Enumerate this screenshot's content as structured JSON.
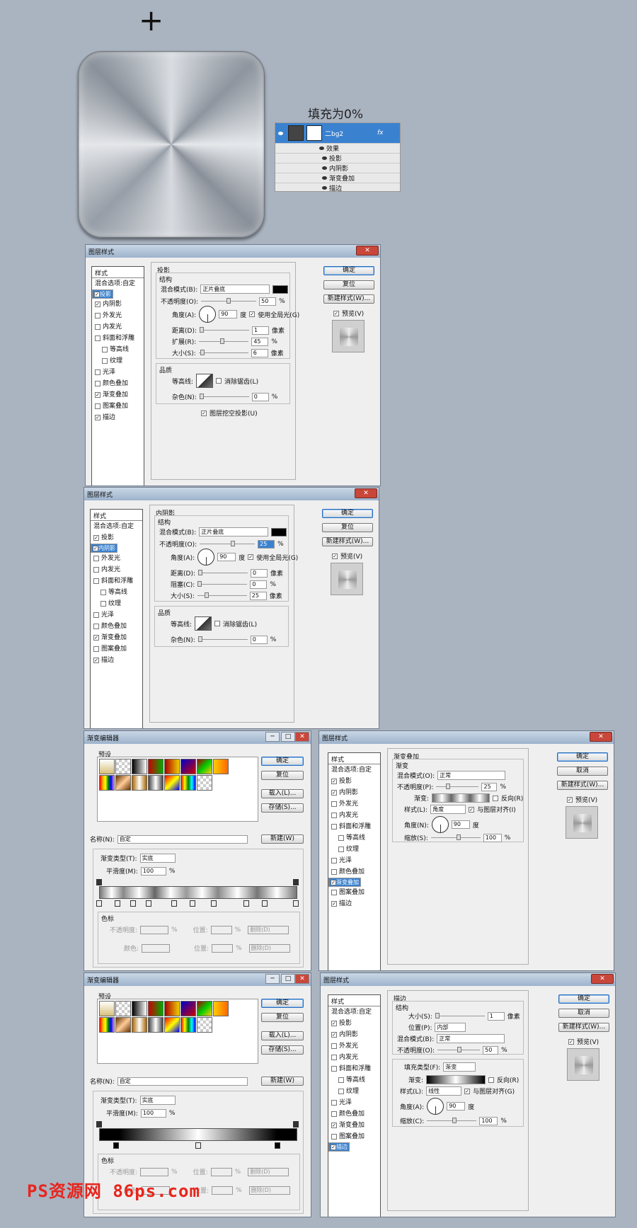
{
  "canvas": {
    "plus_glyph": "+"
  },
  "layers_panel": {
    "fill_label": "填充为0%",
    "layer_name": "二bg2",
    "fx": "fx",
    "effects_header": "效果",
    "effects": [
      "投影",
      "内阴影",
      "渐变叠加",
      "描边"
    ]
  },
  "style_list": {
    "header": "样式",
    "items": [
      "混合选项:自定",
      "投影",
      "内阴影",
      "外发光",
      "内发光",
      "斜面和浮雕",
      "等高线",
      "纹理",
      "光泽",
      "颜色叠加",
      "渐变叠加",
      "图案叠加",
      "描边"
    ]
  },
  "buttons": {
    "ok": "确定",
    "reset": "复位",
    "cancel": "取消",
    "new_style": "新建样式(W)...",
    "preview": "预览(V)",
    "load": "载入(L)...",
    "save": "存储(S)...",
    "new": "新建(W)",
    "delete": "删除(D)"
  },
  "dlg_title": "图层样式",
  "drop_shadow": {
    "section": "投影",
    "structure": "结构",
    "blend_label": "混合模式(B):",
    "blend": "正片叠底",
    "opacity_label": "不透明度(O):",
    "opacity": "50",
    "angle_label": "角度(A):",
    "angle": "90",
    "deg": "度",
    "global": "使用全局光(G)",
    "distance_label": "距离(D):",
    "distance": "1",
    "spread_label": "扩展(R):",
    "spread": "45",
    "size_label": "大小(S):",
    "size": "6",
    "px": "像素",
    "pct": "%",
    "quality": "品质",
    "contour_label": "等高线:",
    "antialias": "消除锯齿(L)",
    "noise_label": "杂色(N):",
    "noise": "0",
    "knockout": "图层挖空投影(U)"
  },
  "inner_shadow": {
    "section": "内阴影",
    "structure": "结构",
    "blend_label": "混合模式(B):",
    "blend": "正片叠底",
    "opacity_label": "不透明度(O):",
    "opacity": "25",
    "angle_label": "角度(A):",
    "angle": "90",
    "deg": "度",
    "global": "使用全局光(G)",
    "distance_label": "距离(D):",
    "distance": "0",
    "choke_label": "阻塞(C):",
    "choke": "0",
    "size_label": "大小(S):",
    "size": "25",
    "px": "像素",
    "pct": "%",
    "quality": "品质",
    "contour_label": "等高线:",
    "antialias": "消除锯齿(L)",
    "noise_label": "杂色(N):",
    "noise": "0"
  },
  "gradient_editor": {
    "title": "渐变编辑器",
    "presets": "预设",
    "name_label_1": "名称(N):",
    "name_label_2": "名称(N):",
    "name": "自定",
    "type_label": "渐变类型(T):",
    "type": "实底",
    "smooth_label": "平滑度(M):",
    "smooth": "100",
    "pct": "%",
    "stops": "色标",
    "opacity_label": "不透明度:",
    "color_label": "颜色:",
    "position_label": "位置:"
  },
  "gradient_overlay": {
    "section": "渐变叠加",
    "sub": "渐变",
    "blend_label": "混合模式(O):",
    "blend": "正常",
    "opacity_label": "不透明度(P):",
    "opacity": "25",
    "gradient_label": "渐变:",
    "reverse": "反向(R)",
    "style_label": "样式(L):",
    "style": "角度",
    "align": "与图层对齐(I)",
    "angle_label": "角度(N):",
    "angle": "90",
    "deg": "度",
    "scale_label": "缩放(S):",
    "scale": "100",
    "pct": "%"
  },
  "stroke": {
    "section": "描边",
    "structure": "结构",
    "size_label": "大小(S):",
    "size": "1",
    "px": "像素",
    "position_label": "位置(P):",
    "position": "内部",
    "blend_label": "混合模式(B):",
    "blend": "正常",
    "opacity_label": "不透明度(O):",
    "opacity": "50",
    "pct": "%",
    "fill_type_label": "填充类型(F):",
    "fill_type": "渐变",
    "gradient_label": "渐变:",
    "reverse": "反向(R)",
    "style_label": "样式(L):",
    "style": "线性",
    "align": "与图层对齐(G)",
    "angle_label": "角度(A):",
    "angle": "90",
    "deg": "度",
    "scale_label": "缩放(C):",
    "scale": "100"
  },
  "watermark": "PS资源网 86ps.com",
  "colors": {
    "accent": "#3a82d0",
    "bg": "#aab3c0",
    "watermark": "#e8251c"
  }
}
